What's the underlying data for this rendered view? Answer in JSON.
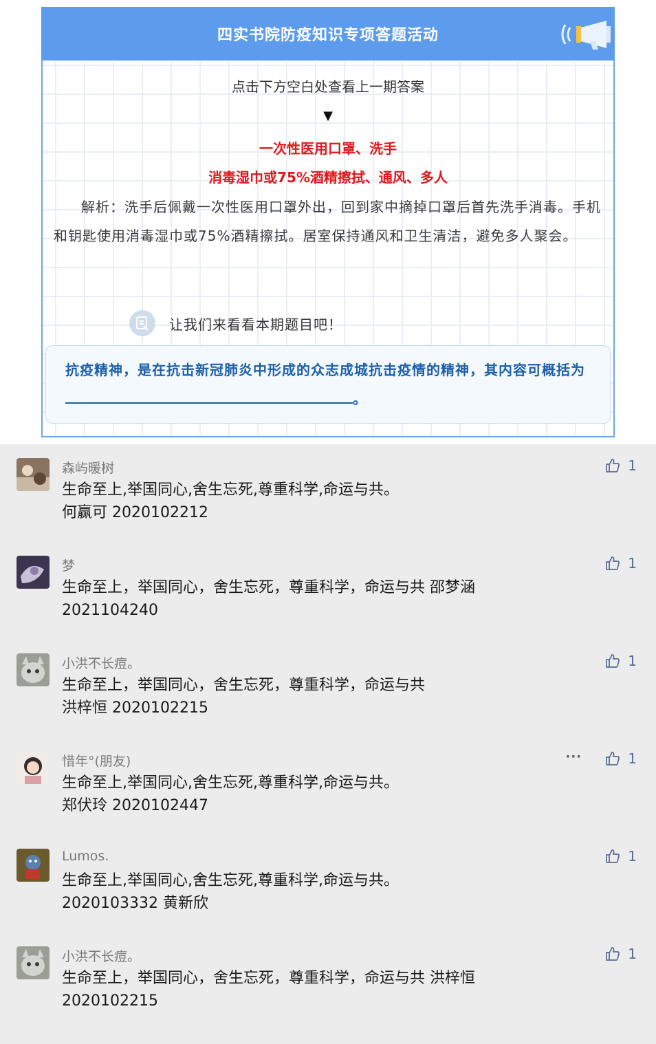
{
  "article": {
    "title": "四实书院防疫知识专项答题活动",
    "hint": "点击下方空白处查看上一期答案",
    "arrow": "▼",
    "answer_line1": "一次性医用口罩、洗手",
    "answer_line2": "消毒湿巾或75%酒精擦拭、通风、多人",
    "analysis": "解析：洗手后佩戴一次性医用口罩外出，回到家中摘掉口罩后首先洗手消毒。手机和钥匙使用消毒湿巾或75%酒精擦拭。居室保持通风和卫生清洁，避免多人聚会。",
    "lead_text": "让我们来看看本期题目吧！",
    "question_text": "抗疫精神，是在抗击新冠肺炎中形成的众志成城抗击疫情的精神，其内容可概括为",
    "question_end": "。"
  },
  "comments": [
    {
      "nickname": "森屿暖树",
      "line1": "生命至上,举国同心,舍生忘死,尊重科学,命运与共。",
      "line2": "何赢可 2020102212",
      "likes": "1"
    },
    {
      "nickname": "梦",
      "line1": "生命至上，举国同心，舍生忘死，尊重科学，命运与共  邵梦涵",
      "line2": "2021104240",
      "likes": "1"
    },
    {
      "nickname": "小洪不长痘。",
      "line1": "生命至上，举国同心，舍生忘死，尊重科学，命运与共",
      "line2": "洪梓恒  2020102215",
      "likes": "1"
    },
    {
      "nickname": "惜年°(朋友)",
      "line1": "生命至上,举国同心,舍生忘死,尊重科学,命运与共。",
      "line2": "郑伏玲 2020102447",
      "likes": "1",
      "more": "···"
    },
    {
      "nickname": "Lumos.",
      "line1": "生命至上,举国同心,舍生忘死,尊重科学,命运与共。",
      "line2": "2020103332 黄新欣",
      "likes": "1"
    },
    {
      "nickname": "小洪不长痘。",
      "line1": "生命至上，举国同心，舍生忘死，尊重科学，命运与共  洪梓恒",
      "line2": "2020102215",
      "likes": "1"
    }
  ],
  "colors": {
    "header_blue": "#5d9cec",
    "answer_red": "#e0181b",
    "question_blue": "#1d5fa8",
    "like_blue": "#576b95"
  },
  "icons": {
    "header": "megaphone-icon",
    "lead": "message-icon",
    "like": "thumbs-up-icon",
    "more": "more-icon"
  }
}
